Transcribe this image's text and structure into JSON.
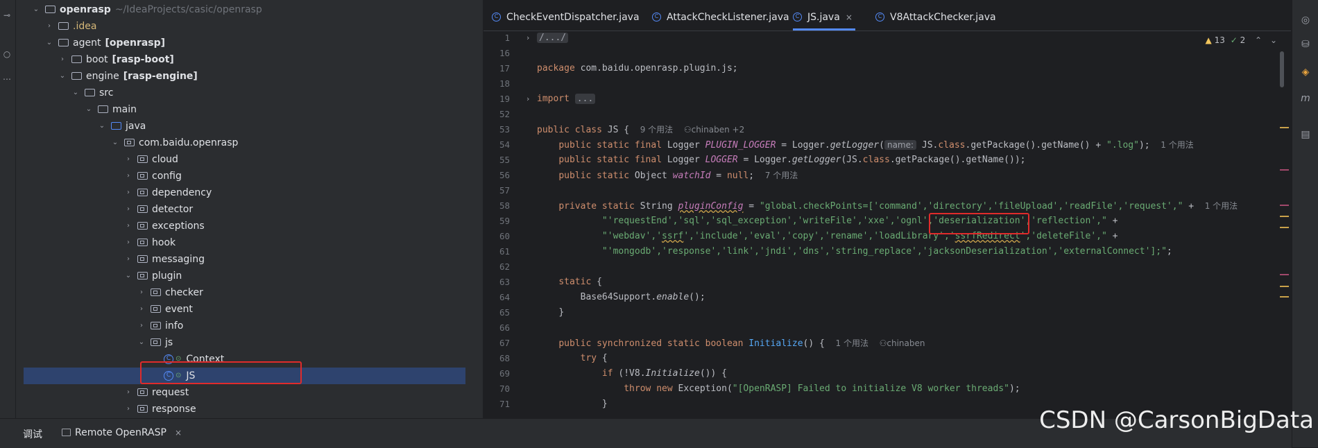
{
  "project": {
    "tree": [
      {
        "label": "openrasp",
        "suffix": "~/IdeaProjects/casic/openrasp",
        "kind": "module",
        "expanded": true,
        "bold": true
      },
      {
        "label": ".idea",
        "kind": "folder",
        "expanded": false,
        "color": "yellow"
      },
      {
        "label": "agent",
        "suffix": "[openrasp]",
        "kind": "module",
        "expanded": true
      },
      {
        "label": "boot",
        "suffix": "[rasp-boot]",
        "kind": "module",
        "expanded": false
      },
      {
        "label": "engine",
        "suffix": "[rasp-engine]",
        "kind": "module",
        "expanded": true
      },
      {
        "label": "src",
        "kind": "folder",
        "expanded": true
      },
      {
        "label": "main",
        "kind": "folder",
        "expanded": true
      },
      {
        "label": "java",
        "kind": "source-folder",
        "expanded": true
      },
      {
        "label": "com.baidu.openrasp",
        "kind": "package",
        "expanded": true
      },
      {
        "label": "cloud",
        "kind": "package",
        "expanded": false
      },
      {
        "label": "config",
        "kind": "package",
        "expanded": false
      },
      {
        "label": "dependency",
        "kind": "package",
        "expanded": false
      },
      {
        "label": "detector",
        "kind": "package",
        "expanded": false
      },
      {
        "label": "exceptions",
        "kind": "package",
        "expanded": false
      },
      {
        "label": "hook",
        "kind": "package",
        "expanded": false
      },
      {
        "label": "messaging",
        "kind": "package",
        "expanded": false
      },
      {
        "label": "plugin",
        "kind": "package",
        "expanded": true
      },
      {
        "label": "checker",
        "kind": "package",
        "expanded": false
      },
      {
        "label": "event",
        "kind": "package",
        "expanded": false
      },
      {
        "label": "info",
        "kind": "package",
        "expanded": false
      },
      {
        "label": "js",
        "kind": "package",
        "expanded": true
      },
      {
        "label": "Context",
        "kind": "class"
      },
      {
        "label": "JS",
        "kind": "class",
        "selected": true
      },
      {
        "label": "request",
        "kind": "package",
        "expanded": false
      },
      {
        "label": "response",
        "kind": "package",
        "expanded": false
      }
    ]
  },
  "tabs": [
    {
      "label": "CheckEventDispatcher.java",
      "active": false
    },
    {
      "label": "AttackCheckListener.java",
      "active": false
    },
    {
      "label": "JS.java",
      "active": true,
      "close": "×"
    },
    {
      "label": "V8AttackChecker.java",
      "active": false
    }
  ],
  "editor_status": {
    "warnings": "13",
    "weak_warnings": "2"
  },
  "line_numbers": [
    "1",
    "16",
    "17",
    "18",
    "19",
    "52",
    "53",
    "54",
    "55",
    "56",
    "57",
    "58",
    "59",
    "60",
    "61",
    "62",
    "63",
    "64",
    "65",
    "66",
    "67",
    "68",
    "69",
    "70",
    "71"
  ],
  "code": {
    "l1": "/.../",
    "l17_kw": "package",
    "l17_rest": " com.baidu.openrasp.plugin.js;",
    "l19_kw": "import",
    "l19_fold": "...",
    "l53_kw": "public class",
    "l53_rest": " JS {",
    "l53_hint1": "9 个用法",
    "l53_hint2": "chinaben +2",
    "l54_kw": "public static final",
    "l54_a": " Logger ",
    "l54_fld": "PLUGIN_LOGGER",
    "l54_b": " = Logger.",
    "l54_sfn": "getLogger",
    "l54_c": "(",
    "l54_inlay": "name:",
    "l54_d": " JS.",
    "l54_kw2": "class",
    "l54_e": ".getPackage().getName() + ",
    "l54_str": "\".log\"",
    "l54_f": ");",
    "l54_hint": "1 个用法",
    "l55_kw": "public static final",
    "l55_a": " Logger ",
    "l55_fld": "LOGGER",
    "l55_b": " = Logger.",
    "l55_sfn": "getLogger",
    "l55_c": "(JS.",
    "l55_kw2": "class",
    "l55_d": ".getPackage().getName());",
    "l56_kw": "public static",
    "l56_a": " Object ",
    "l56_fld": "watchId",
    "l56_b": " = ",
    "l56_kw2": "null",
    "l56_c": ";",
    "l56_hint": "7 个用法",
    "l58_kw": "private static",
    "l58_a": " String ",
    "l58_fld": "pluginConfig",
    "l58_b": " = ",
    "l58_str": "\"global.checkPoints=['command','directory','fileUpload','readFile','request',\"",
    "l58_c": " +",
    "l58_hint": "1 个用法",
    "l59_str": "\"'requestEnd','sql','sql_exception','writeFile','xxe','ognl','deserialization','reflection',\"",
    "l59_c": " +",
    "l60_str_a": "\"'webdav','",
    "l60_squig": "ssrf",
    "l60_str_b": "','include','eval','copy','rename','loadLibrary','",
    "l60_squig2": "ssrfRedirect",
    "l60_str_c": "','deleteFile',\"",
    "l60_c": " +",
    "l61_str": "\"'mongodb','response','link','jndi','dns','string_replace','jacksonDeserialization','externalConnect'];\"",
    "l61_c": ";",
    "l63_kw": "static",
    "l63_rest": " {",
    "l64_a": "Base64Support.",
    "l64_sfn": "enable",
    "l64_b": "();",
    "l65": "}",
    "l67_kw": "public synchronized static boolean",
    "l67_sp": " ",
    "l67_mth": "Initialize",
    "l67_rest": "() {",
    "l67_hint1": "1 个用法",
    "l67_hint2": "chinaben",
    "l68_kw": "try",
    "l68_rest": " {",
    "l69_kw": "if",
    "l69_a": " (!V8.",
    "l69_sfn": "Initialize",
    "l69_b": "()) {",
    "l70_kw": "throw new",
    "l70_a": " Exception(",
    "l70_str": "\"[OpenRASP] Failed to initialize V8 worker threads\"",
    "l70_b": ");",
    "l71": "}"
  },
  "bottom": {
    "debug_label": "调试",
    "remote_label": "Remote OpenRASP",
    "close": "×"
  },
  "watermark": "CSDN @CarsonBigData",
  "colors": {
    "selection": "#2e436e",
    "highlight_box": "#e02b2b",
    "accent": "#548af7"
  }
}
